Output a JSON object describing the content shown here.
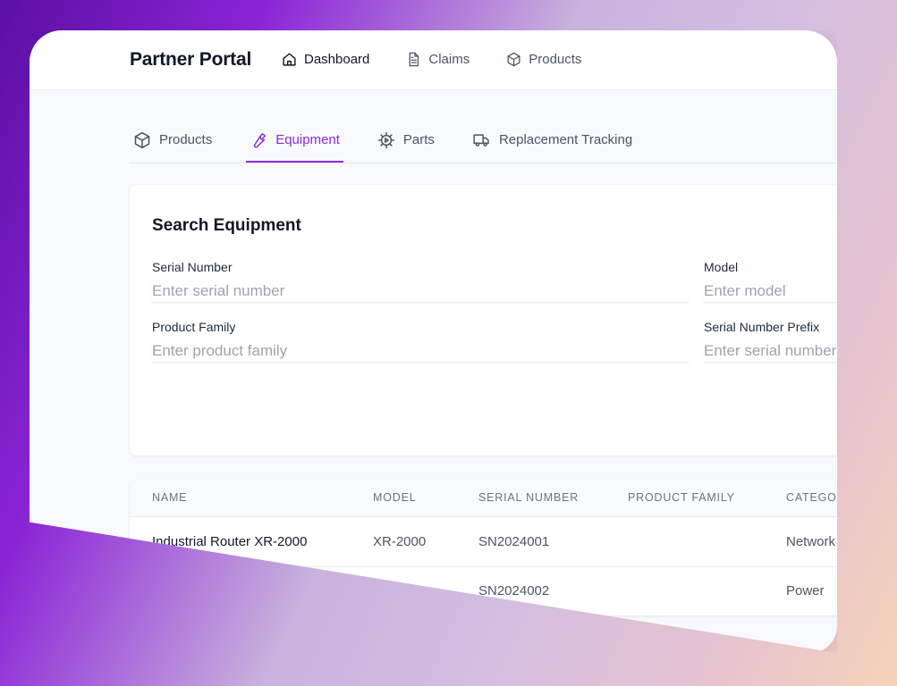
{
  "header": {
    "brand": "Partner Portal",
    "nav": [
      {
        "label": "Dashboard",
        "icon": "home-icon"
      },
      {
        "label": "Claims",
        "icon": "document-icon"
      },
      {
        "label": "Products",
        "icon": "box-icon"
      }
    ]
  },
  "tabs": [
    {
      "label": "Products",
      "icon": "box-icon",
      "active": false
    },
    {
      "label": "Equipment",
      "icon": "wrench-icon",
      "active": true
    },
    {
      "label": "Parts",
      "icon": "gear-icon",
      "active": false
    },
    {
      "label": "Replacement Tracking",
      "icon": "truck-icon",
      "active": false
    }
  ],
  "search": {
    "title": "Search Equipment",
    "fields": {
      "serial_number": {
        "label": "Serial Number",
        "placeholder": "Enter serial number"
      },
      "model": {
        "label": "Model",
        "placeholder": "Enter model"
      },
      "product_family": {
        "label": "Product Family",
        "placeholder": "Enter product family"
      },
      "serial_prefix": {
        "label": "Serial Number Prefix",
        "placeholder": "Enter serial number"
      }
    }
  },
  "table": {
    "columns": [
      "NAME",
      "MODEL",
      "SERIAL NUMBER",
      "PRODUCT FAMILY",
      "CATEGORY"
    ],
    "rows": [
      {
        "name": "Industrial Router XR-2000",
        "model": "XR-2000",
        "serial": "SN2024001",
        "family": "",
        "category": "Network"
      },
      {
        "name": "",
        "model": "",
        "serial": "SN2024002",
        "family": "",
        "category": "Power"
      }
    ]
  },
  "colors": {
    "accent": "#8b2bd8"
  }
}
